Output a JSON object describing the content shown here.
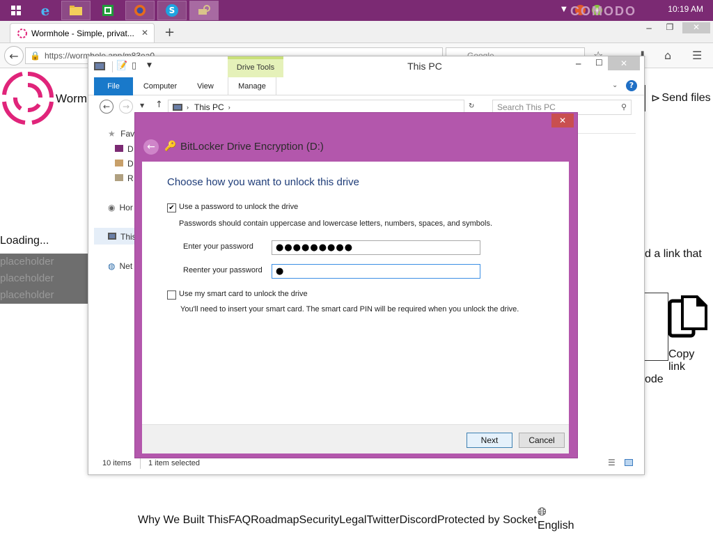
{
  "taskbar": {
    "clock": "10:19 AM",
    "comodo": "COMODO"
  },
  "browser": {
    "tab_title": "Wormhole - Simple, privat...",
    "url": "https://wormhole.app/m83ea0",
    "search_placeholder": "Google"
  },
  "page": {
    "logo_text": "Wormh",
    "send_files": "Send files",
    "loading": "Loading...",
    "placeholders": [
      "placeholder",
      "placeholder",
      "placeholder"
    ],
    "link_text": "d a link that",
    "copy_link": "Copy link",
    "code_text": "ode",
    "footer_links": [
      "Why We Built This",
      "FAQ",
      "Roadmap",
      "Security",
      "Legal",
      "Twitter",
      "Discord",
      "Protected by Socket"
    ],
    "language": "English"
  },
  "explorer": {
    "title": "This PC",
    "context_tab": "Drive Tools",
    "ribbon_tabs": [
      "File",
      "Computer",
      "View",
      "Manage"
    ],
    "breadcrumb": "This PC",
    "search_placeholder": "Search This PC",
    "nav": {
      "favorites": "Fav",
      "fav_items": [
        "D",
        "D",
        "R"
      ],
      "homegroup": "Hor",
      "this_pc": "This",
      "network": "Net"
    },
    "status_items": "10 items",
    "status_selected": "1 item selected"
  },
  "bitlocker": {
    "title": "BitLocker Drive Encryption (D:)",
    "heading": "Choose how you want to unlock this drive",
    "use_password_label": "Use a password to unlock the drive",
    "use_password_checked": true,
    "password_hint": "Passwords should contain uppercase and lowercase letters, numbers, spaces, and symbols.",
    "enter_password_label": "Enter your password",
    "enter_password_value": "●●●●●●●●●",
    "reenter_password_label": "Reenter your password",
    "reenter_password_value": "●",
    "smart_card_label": "Use my smart card to unlock the drive",
    "smart_card_checked": false,
    "smart_card_hint": "You'll need to insert your smart card. The smart card PIN will be required when you unlock the drive.",
    "next_label": "Next",
    "cancel_label": "Cancel",
    "accent_color": "#b357ac"
  }
}
